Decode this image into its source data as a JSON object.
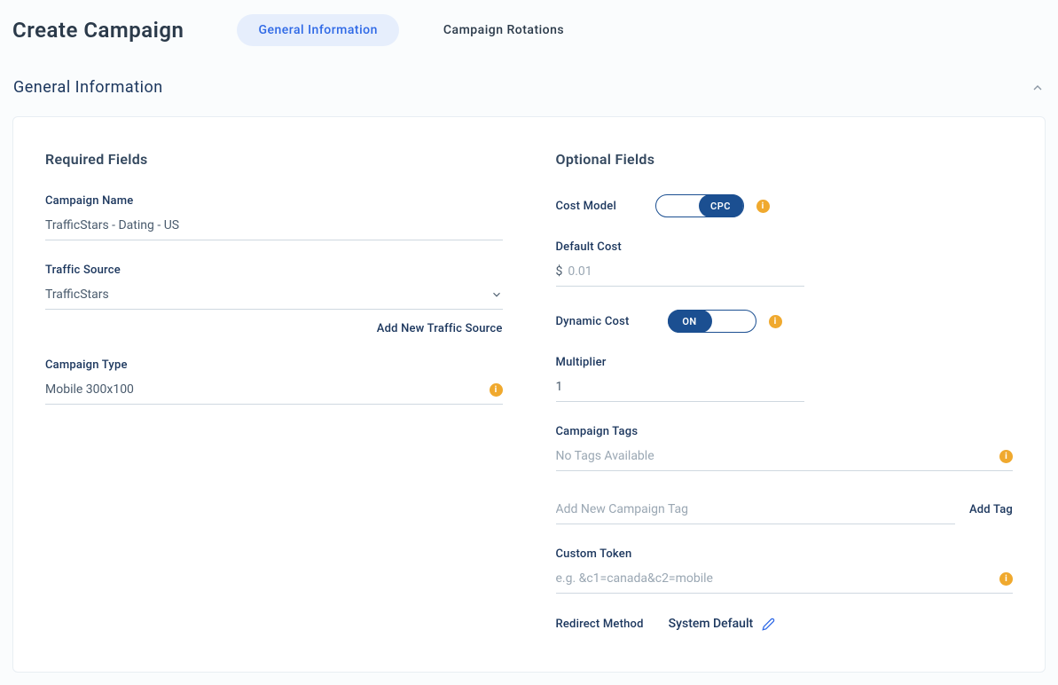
{
  "header": {
    "title": "Create Campaign",
    "tabs": [
      {
        "label": "General Information",
        "active": true
      },
      {
        "label": "Campaign Rotations",
        "active": false
      }
    ]
  },
  "section": {
    "title": "General Information"
  },
  "required": {
    "title": "Required Fields",
    "campaign_name": {
      "label": "Campaign Name",
      "value": "TrafficStars - Dating - US"
    },
    "traffic_source": {
      "label": "Traffic Source",
      "value": "TrafficStars",
      "add_link": "Add New Traffic Source"
    },
    "campaign_type": {
      "label": "Campaign Type",
      "value": "Mobile 300x100"
    }
  },
  "optional": {
    "title": "Optional Fields",
    "cost_model": {
      "label": "Cost Model",
      "value": "CPC"
    },
    "default_cost": {
      "label": "Default Cost",
      "currency": "$",
      "value": "0.01"
    },
    "dynamic_cost": {
      "label": "Dynamic Cost",
      "value": "ON"
    },
    "multiplier": {
      "label": "Multiplier",
      "value": "1"
    },
    "campaign_tags": {
      "label": "Campaign Tags",
      "placeholder": "No Tags Available",
      "add_placeholder": "Add New Campaign Tag",
      "add_link": "Add Tag"
    },
    "custom_token": {
      "label": "Custom Token",
      "placeholder": "e.g. &c1=canada&c2=mobile"
    },
    "redirect_method": {
      "label": "Redirect Method",
      "value": "System Default"
    }
  }
}
